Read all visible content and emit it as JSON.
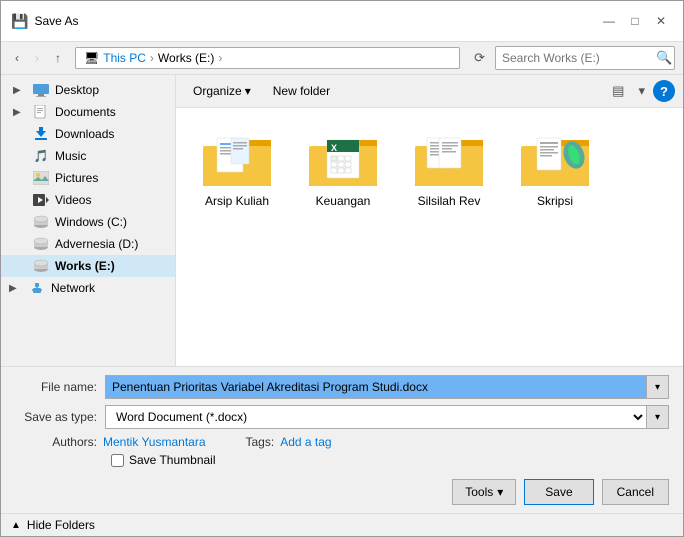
{
  "dialog": {
    "title": "Save As",
    "titlebar": {
      "icon": "💾",
      "minimize": "—",
      "maximize": "□",
      "close": "✕"
    }
  },
  "toolbar": {
    "back_btn": "‹",
    "forward_btn": "›",
    "up_btn": "↑",
    "breadcrumb": {
      "parts": [
        "This PC",
        "Works (E:)"
      ],
      "icon": "🖥"
    },
    "refresh_btn": "⟳",
    "search_placeholder": "Search Works (E:)",
    "search_icon": "🔍"
  },
  "content_toolbar": {
    "organize_label": "Organize",
    "new_folder_label": "New folder",
    "view_icon": "▤",
    "dropdown_icon": "▾",
    "help": "?"
  },
  "sidebar": {
    "items": [
      {
        "id": "desktop",
        "label": "Desktop",
        "icon": "desktop",
        "expanded": true,
        "indent": 1
      },
      {
        "id": "documents",
        "label": "Documents",
        "icon": "docs",
        "expanded": true,
        "indent": 1
      },
      {
        "id": "downloads",
        "label": "Downloads",
        "icon": "download",
        "expanded": false,
        "indent": 1
      },
      {
        "id": "music",
        "label": "Music",
        "icon": "music",
        "expanded": false,
        "indent": 1
      },
      {
        "id": "pictures",
        "label": "Pictures",
        "icon": "pictures",
        "expanded": false,
        "indent": 1
      },
      {
        "id": "videos",
        "label": "Videos",
        "icon": "videos",
        "expanded": false,
        "indent": 1
      },
      {
        "id": "windows",
        "label": "Windows (C:)",
        "icon": "drive",
        "expanded": false,
        "indent": 1
      },
      {
        "id": "advernesia",
        "label": "Advernesia (D:)",
        "icon": "drive",
        "expanded": false,
        "indent": 1
      },
      {
        "id": "works",
        "label": "Works (E:)",
        "icon": "drive",
        "expanded": false,
        "indent": 1,
        "selected": true
      },
      {
        "id": "network",
        "label": "Network",
        "icon": "network",
        "expanded": false,
        "indent": 0
      }
    ]
  },
  "folders": [
    {
      "id": "arsip-kuliah",
      "label": "Arsip Kuliah",
      "type": "papers"
    },
    {
      "id": "keuangan",
      "label": "Keuangan",
      "type": "excel"
    },
    {
      "id": "silsilah-rev",
      "label": "Silsilah Rev",
      "type": "papers2"
    },
    {
      "id": "skripsi",
      "label": "Skripsi",
      "type": "papers3"
    }
  ],
  "form": {
    "filename_label": "File name:",
    "filename_value": "Penentuan Prioritas Variabel Akreditasi Program Studi.docx",
    "savetype_label": "Save as type:",
    "savetype_value": "Word Document (*.docx)",
    "authors_label": "Authors:",
    "authors_value": "Mentik Yusmantara",
    "tags_label": "Tags:",
    "tags_value": "Add a tag",
    "thumbnail_label": "Save Thumbnail"
  },
  "actions": {
    "tools_label": "Tools",
    "save_label": "Save",
    "cancel_label": "Cancel"
  },
  "footer": {
    "hide_folders_label": "Hide Folders"
  }
}
